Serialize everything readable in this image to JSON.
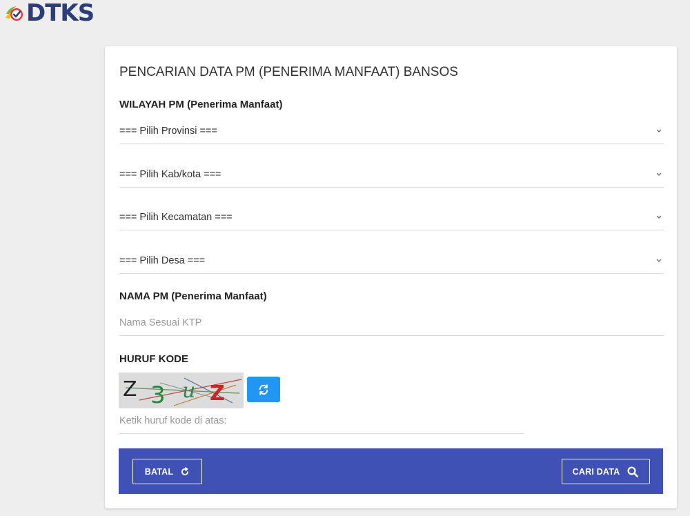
{
  "brand": {
    "logo_text": "DTKS",
    "colors": {
      "navy": "#2c3e7a",
      "green": "#7cb342",
      "yellow": "#f4c20d",
      "red": "#e53935"
    }
  },
  "form": {
    "title": "PENCARIAN DATA PM (PENERIMA MANFAAT) BANSOS",
    "wilayah_label": "WILAYAH PM (Penerima Manfaat)",
    "selects": [
      {
        "placeholder": "=== Pilih Provinsi ==="
      },
      {
        "placeholder": "=== Pilih Kab/kota ==="
      },
      {
        "placeholder": "=== Pilih Kecamatan ==="
      },
      {
        "placeholder": "=== Pilih Desa ==="
      }
    ],
    "nama_label": "NAMA PM (Penerima Manfaat)",
    "nama_placeholder": "Nama Sesuai KTP",
    "kode_label": "HURUF KODE",
    "captcha_chars": [
      "Z",
      "3",
      "u",
      "Z"
    ],
    "kode_placeholder": "Ketik huruf kode di atas:"
  },
  "actions": {
    "cancel_label": "BATAL",
    "search_label": "CARI DATA",
    "bar_color": "#3f51b5",
    "refresh_color": "#2196f3"
  },
  "icons": {
    "refresh": "refresh-icon",
    "reload": "reload-icon",
    "search": "search-icon",
    "chevron": "chevron-down-icon"
  }
}
